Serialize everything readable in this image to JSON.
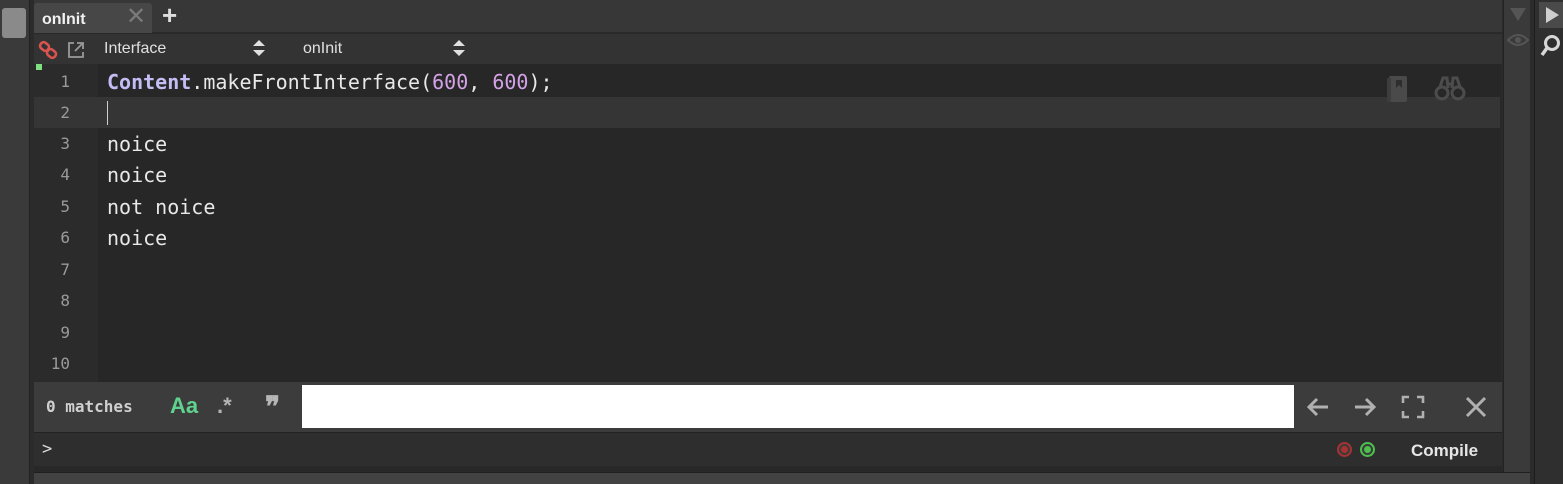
{
  "tab": {
    "label": "onInit",
    "close_icon": "close-icon",
    "add_icon": "plus-icon"
  },
  "toolbar": {
    "link_icon": "link-icon",
    "popout_icon": "popout-icon",
    "interface_combo": "Interface",
    "callback_combo": "onInit"
  },
  "editor": {
    "current_line": 2,
    "lines": [
      {
        "number": "1",
        "text": ""
      },
      {
        "number": "2",
        "text": ""
      },
      {
        "number": "3",
        "text": "noice"
      },
      {
        "number": "4",
        "text": "noice"
      },
      {
        "number": "5",
        "text": "not noice"
      },
      {
        "number": "6",
        "text": "noice"
      },
      {
        "number": "7",
        "text": ""
      },
      {
        "number": "8",
        "text": ""
      },
      {
        "number": "9",
        "text": ""
      },
      {
        "number": "10",
        "text": ""
      }
    ],
    "line1": {
      "object": "Content",
      "method": ".makeFrontInterface(",
      "arg1": "600",
      "sep": ", ",
      "arg2": "600",
      "end": ");"
    },
    "bookmark_icon": "bookmark-icon",
    "find_icon": "binoculars-icon"
  },
  "search": {
    "matches": "0 matches",
    "case_option": "Aa",
    "regex_option": ".*",
    "whole_word_option": "❞",
    "value": "",
    "placeholder": ""
  },
  "console": {
    "prompt": ">",
    "compile_label": "Compile"
  },
  "colors": {
    "accent_green": "#7ee07e",
    "status_red": "#a83232",
    "status_green": "#4cc24c",
    "keyword": "#c4bdf5",
    "number": "#d4a2e6"
  }
}
